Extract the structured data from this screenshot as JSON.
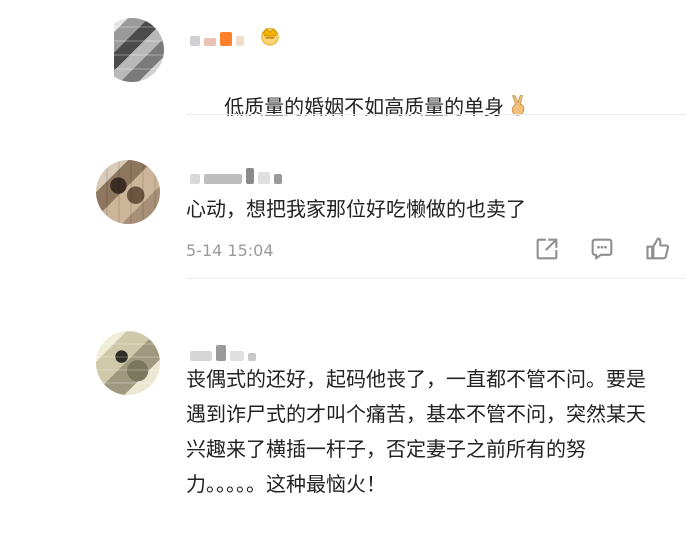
{
  "comments": [
    {
      "text": "低质量的婚姻不如高质量的单身",
      "icons": [
        "crown-badge-icon",
        "victory-hand-icon"
      ]
    },
    {
      "text": "心动，想把我家那位好吃懒做的也卖了",
      "timestamp": "5-14 15:04",
      "actions": [
        "share-icon",
        "reply-icon",
        "like-icon"
      ]
    },
    {
      "text": "丧偶式的还好，起码他丧了，一直都不管不问。要是遇到诈尸式的才叫个痛苦，基本不管不问，突然某天兴趣来了横插一杆子，否定妻子之前所有的努力。。。。。这种最恼火！"
    }
  ],
  "colors": {
    "text": "#222222",
    "muted": "#9a9a9a",
    "blurred": "#c9c9c9",
    "badge": "#f4b400",
    "victory": "#f2c27b"
  }
}
